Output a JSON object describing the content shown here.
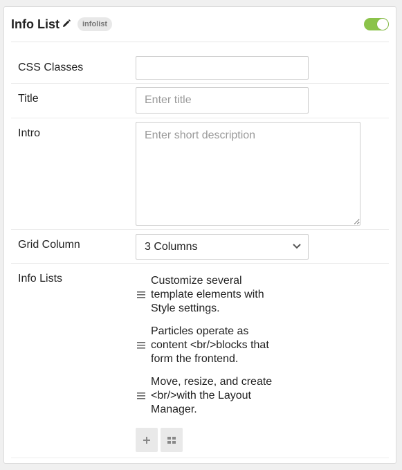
{
  "header": {
    "title": "Info List",
    "badge": "infolist",
    "enabled": true,
    "accent_color": "#8bc34a"
  },
  "fields": {
    "css_classes": {
      "label": "CSS Classes",
      "value": "",
      "placeholder": ""
    },
    "title": {
      "label": "Title",
      "value": "",
      "placeholder": "Enter title"
    },
    "intro": {
      "label": "Intro",
      "value": "",
      "placeholder": "Enter short description"
    },
    "grid_column": {
      "label": "Grid Column",
      "selected": "3 Columns"
    }
  },
  "info_lists": {
    "label": "Info Lists",
    "items": [
      {
        "text": "Customize several template elements with Style settings."
      },
      {
        "text": "Particles operate as content <br/>blocks that form the frontend."
      },
      {
        "text": "Move, resize, and create <br/>with the Layout Manager."
      }
    ],
    "add_icon": "plus-icon",
    "grid_icon": "grid-icon"
  }
}
